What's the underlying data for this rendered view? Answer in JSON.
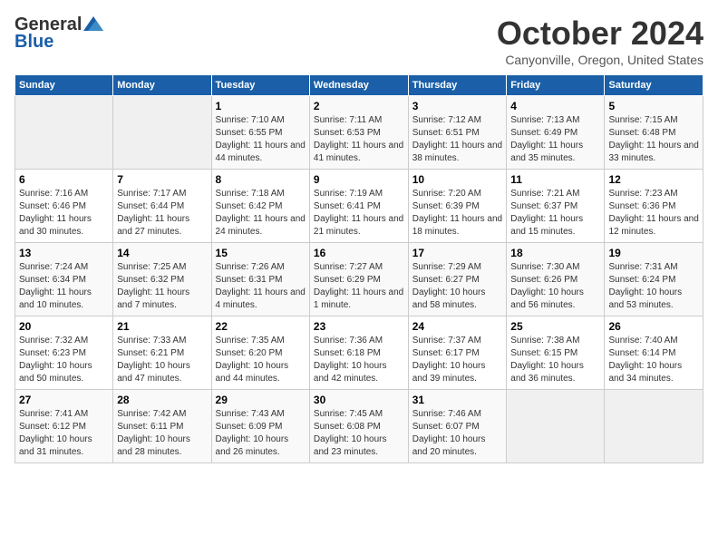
{
  "header": {
    "logo": {
      "general": "General",
      "blue": "Blue"
    },
    "title": "October 2024",
    "location": "Canyonville, Oregon, United States"
  },
  "weekdays": [
    "Sunday",
    "Monday",
    "Tuesday",
    "Wednesday",
    "Thursday",
    "Friday",
    "Saturday"
  ],
  "weeks": [
    [
      {
        "day": "",
        "empty": true
      },
      {
        "day": "",
        "empty": true
      },
      {
        "day": "1",
        "sunrise": "Sunrise: 7:10 AM",
        "sunset": "Sunset: 6:55 PM",
        "daylight": "Daylight: 11 hours and 44 minutes."
      },
      {
        "day": "2",
        "sunrise": "Sunrise: 7:11 AM",
        "sunset": "Sunset: 6:53 PM",
        "daylight": "Daylight: 11 hours and 41 minutes."
      },
      {
        "day": "3",
        "sunrise": "Sunrise: 7:12 AM",
        "sunset": "Sunset: 6:51 PM",
        "daylight": "Daylight: 11 hours and 38 minutes."
      },
      {
        "day": "4",
        "sunrise": "Sunrise: 7:13 AM",
        "sunset": "Sunset: 6:49 PM",
        "daylight": "Daylight: 11 hours and 35 minutes."
      },
      {
        "day": "5",
        "sunrise": "Sunrise: 7:15 AM",
        "sunset": "Sunset: 6:48 PM",
        "daylight": "Daylight: 11 hours and 33 minutes."
      }
    ],
    [
      {
        "day": "6",
        "sunrise": "Sunrise: 7:16 AM",
        "sunset": "Sunset: 6:46 PM",
        "daylight": "Daylight: 11 hours and 30 minutes."
      },
      {
        "day": "7",
        "sunrise": "Sunrise: 7:17 AM",
        "sunset": "Sunset: 6:44 PM",
        "daylight": "Daylight: 11 hours and 27 minutes."
      },
      {
        "day": "8",
        "sunrise": "Sunrise: 7:18 AM",
        "sunset": "Sunset: 6:42 PM",
        "daylight": "Daylight: 11 hours and 24 minutes."
      },
      {
        "day": "9",
        "sunrise": "Sunrise: 7:19 AM",
        "sunset": "Sunset: 6:41 PM",
        "daylight": "Daylight: 11 hours and 21 minutes."
      },
      {
        "day": "10",
        "sunrise": "Sunrise: 7:20 AM",
        "sunset": "Sunset: 6:39 PM",
        "daylight": "Daylight: 11 hours and 18 minutes."
      },
      {
        "day": "11",
        "sunrise": "Sunrise: 7:21 AM",
        "sunset": "Sunset: 6:37 PM",
        "daylight": "Daylight: 11 hours and 15 minutes."
      },
      {
        "day": "12",
        "sunrise": "Sunrise: 7:23 AM",
        "sunset": "Sunset: 6:36 PM",
        "daylight": "Daylight: 11 hours and 12 minutes."
      }
    ],
    [
      {
        "day": "13",
        "sunrise": "Sunrise: 7:24 AM",
        "sunset": "Sunset: 6:34 PM",
        "daylight": "Daylight: 11 hours and 10 minutes."
      },
      {
        "day": "14",
        "sunrise": "Sunrise: 7:25 AM",
        "sunset": "Sunset: 6:32 PM",
        "daylight": "Daylight: 11 hours and 7 minutes."
      },
      {
        "day": "15",
        "sunrise": "Sunrise: 7:26 AM",
        "sunset": "Sunset: 6:31 PM",
        "daylight": "Daylight: 11 hours and 4 minutes."
      },
      {
        "day": "16",
        "sunrise": "Sunrise: 7:27 AM",
        "sunset": "Sunset: 6:29 PM",
        "daylight": "Daylight: 11 hours and 1 minute."
      },
      {
        "day": "17",
        "sunrise": "Sunrise: 7:29 AM",
        "sunset": "Sunset: 6:27 PM",
        "daylight": "Daylight: 10 hours and 58 minutes."
      },
      {
        "day": "18",
        "sunrise": "Sunrise: 7:30 AM",
        "sunset": "Sunset: 6:26 PM",
        "daylight": "Daylight: 10 hours and 56 minutes."
      },
      {
        "day": "19",
        "sunrise": "Sunrise: 7:31 AM",
        "sunset": "Sunset: 6:24 PM",
        "daylight": "Daylight: 10 hours and 53 minutes."
      }
    ],
    [
      {
        "day": "20",
        "sunrise": "Sunrise: 7:32 AM",
        "sunset": "Sunset: 6:23 PM",
        "daylight": "Daylight: 10 hours and 50 minutes."
      },
      {
        "day": "21",
        "sunrise": "Sunrise: 7:33 AM",
        "sunset": "Sunset: 6:21 PM",
        "daylight": "Daylight: 10 hours and 47 minutes."
      },
      {
        "day": "22",
        "sunrise": "Sunrise: 7:35 AM",
        "sunset": "Sunset: 6:20 PM",
        "daylight": "Daylight: 10 hours and 44 minutes."
      },
      {
        "day": "23",
        "sunrise": "Sunrise: 7:36 AM",
        "sunset": "Sunset: 6:18 PM",
        "daylight": "Daylight: 10 hours and 42 minutes."
      },
      {
        "day": "24",
        "sunrise": "Sunrise: 7:37 AM",
        "sunset": "Sunset: 6:17 PM",
        "daylight": "Daylight: 10 hours and 39 minutes."
      },
      {
        "day": "25",
        "sunrise": "Sunrise: 7:38 AM",
        "sunset": "Sunset: 6:15 PM",
        "daylight": "Daylight: 10 hours and 36 minutes."
      },
      {
        "day": "26",
        "sunrise": "Sunrise: 7:40 AM",
        "sunset": "Sunset: 6:14 PM",
        "daylight": "Daylight: 10 hours and 34 minutes."
      }
    ],
    [
      {
        "day": "27",
        "sunrise": "Sunrise: 7:41 AM",
        "sunset": "Sunset: 6:12 PM",
        "daylight": "Daylight: 10 hours and 31 minutes."
      },
      {
        "day": "28",
        "sunrise": "Sunrise: 7:42 AM",
        "sunset": "Sunset: 6:11 PM",
        "daylight": "Daylight: 10 hours and 28 minutes."
      },
      {
        "day": "29",
        "sunrise": "Sunrise: 7:43 AM",
        "sunset": "Sunset: 6:09 PM",
        "daylight": "Daylight: 10 hours and 26 minutes."
      },
      {
        "day": "30",
        "sunrise": "Sunrise: 7:45 AM",
        "sunset": "Sunset: 6:08 PM",
        "daylight": "Daylight: 10 hours and 23 minutes."
      },
      {
        "day": "31",
        "sunrise": "Sunrise: 7:46 AM",
        "sunset": "Sunset: 6:07 PM",
        "daylight": "Daylight: 10 hours and 20 minutes."
      },
      {
        "day": "",
        "empty": true
      },
      {
        "day": "",
        "empty": true
      }
    ]
  ]
}
